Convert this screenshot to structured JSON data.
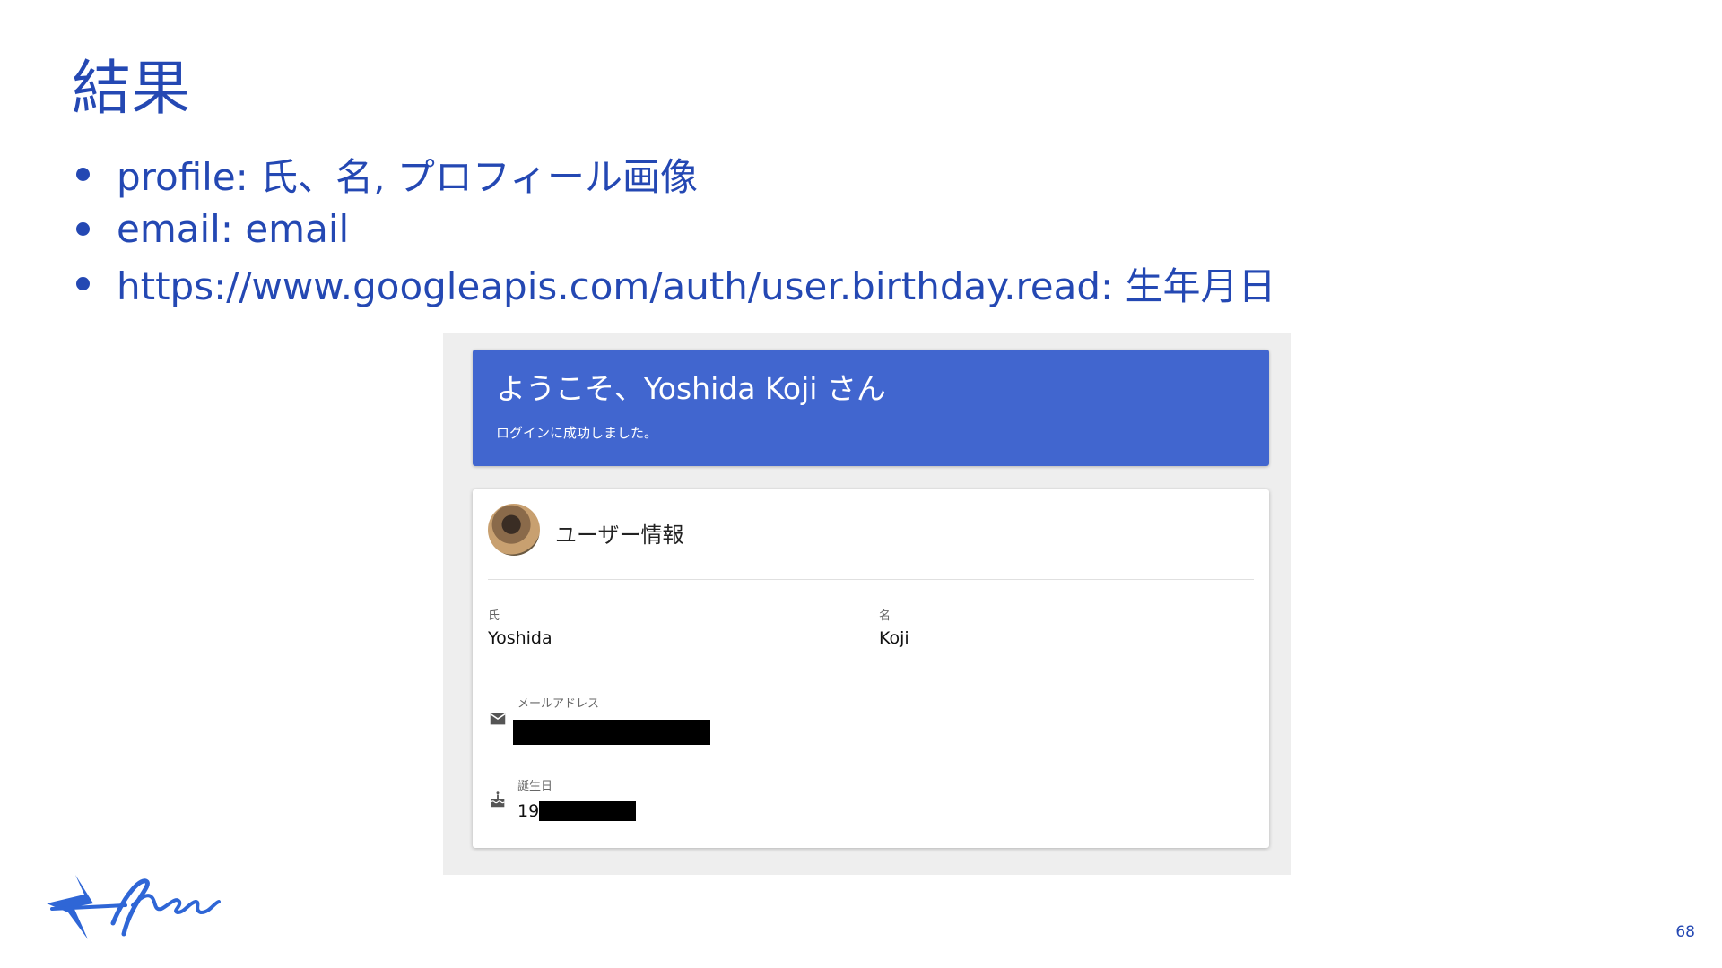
{
  "slide": {
    "title": "結果",
    "bullets": [
      "profile: 氏、名, プロフィール画像",
      "email: email",
      "https://www.googleapis.com/auth/user.birthday.read: 生年月日"
    ],
    "page_number": "68",
    "logo_text": "freee"
  },
  "app": {
    "welcome": {
      "title": "ようこそ、Yoshida Koji さん",
      "subtitle": "ログインに成功しました。"
    },
    "user_info": {
      "title": "ユーザー情報",
      "last_name_label": "氏",
      "last_name_value": "Yoshida",
      "first_name_label": "名",
      "first_name_value": "Koji",
      "email_label": "メールアドレス",
      "birthday_label": "誕生日",
      "birthday_visible_prefix": "19"
    }
  },
  "colors": {
    "slide_accent": "#2448b3",
    "welcome_bg": "#4166cf"
  },
  "icons": {
    "email": "mail-icon",
    "birthday": "cake-icon"
  }
}
